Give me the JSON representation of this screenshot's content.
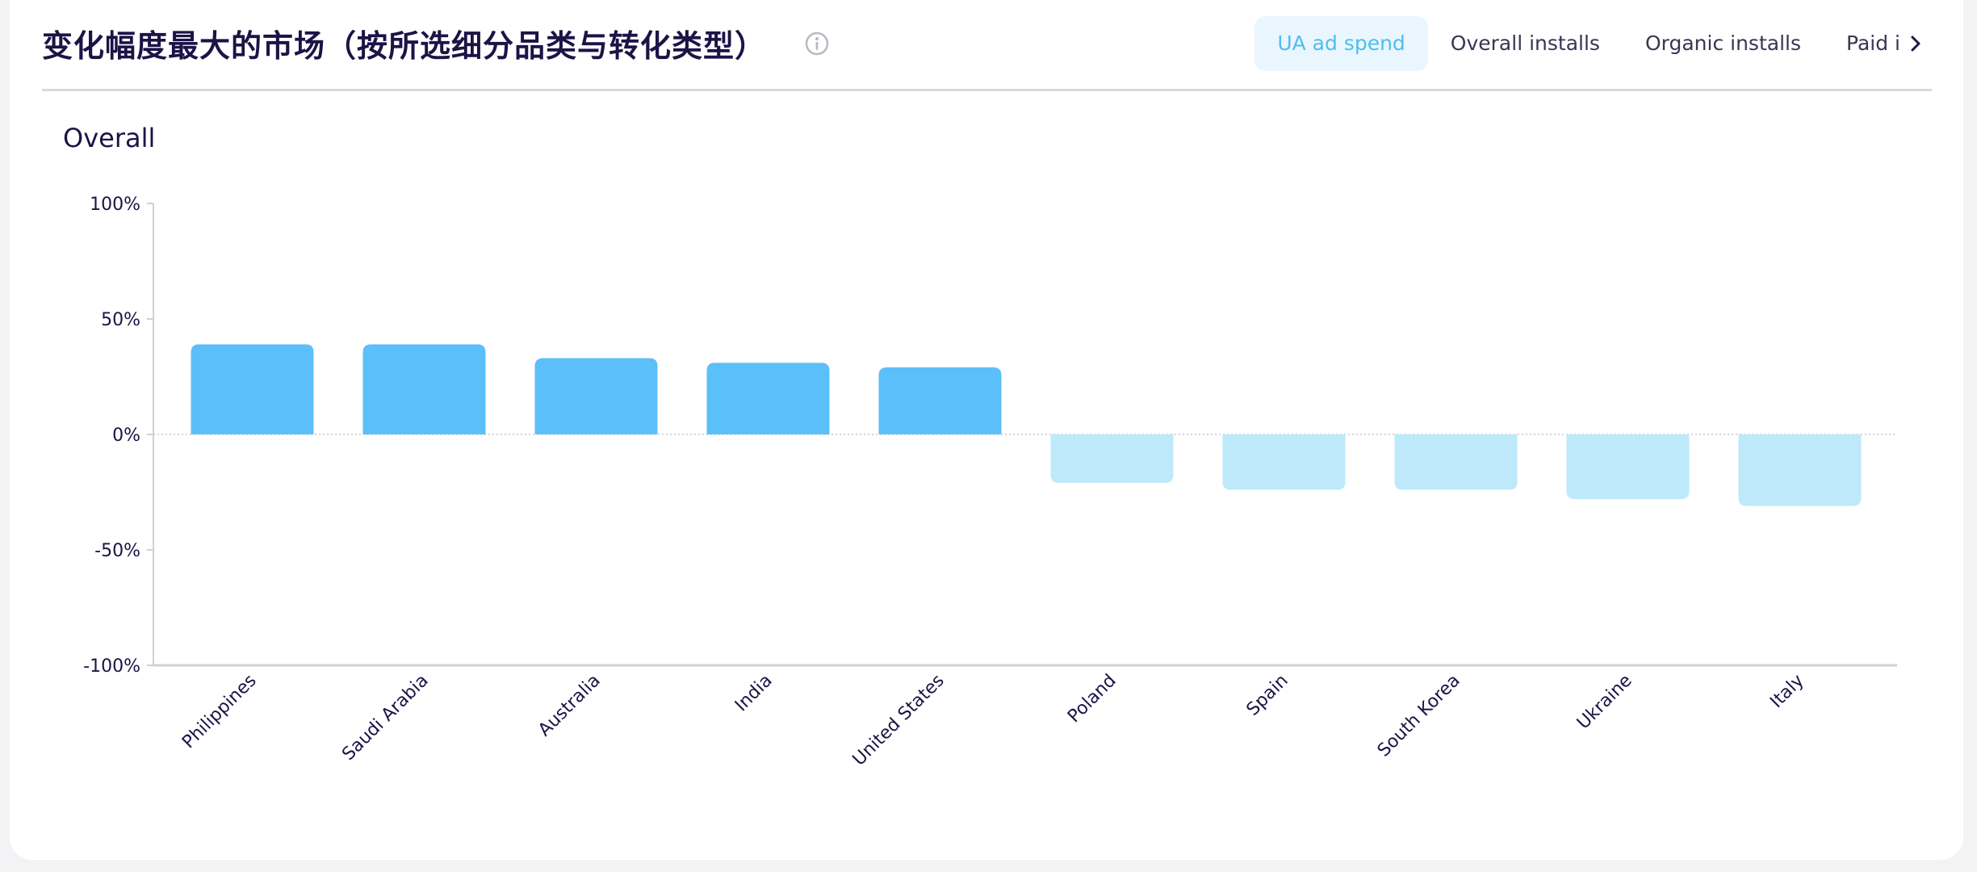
{
  "header": {
    "title": "变化幅度最大的市场（按所选细分品类与转化类型）",
    "info_icon": "info-icon",
    "tabs": [
      {
        "label": "UA ad spend",
        "active": true
      },
      {
        "label": "Overall installs",
        "active": false
      },
      {
        "label": "Organic installs",
        "active": false
      },
      {
        "label": "Paid installs",
        "active": false
      }
    ],
    "next_icon": "chevron-right-icon"
  },
  "section": {
    "title": "Overall"
  },
  "colors": {
    "positive": "#5bbff9",
    "negative": "#bde9fb",
    "accent": "#4fbdf0",
    "axis": "#d0d0d5"
  },
  "chart_data": {
    "type": "bar",
    "title": "Overall",
    "categories": [
      "Philippines",
      "Saudi Arabia",
      "Australia",
      "India",
      "United States",
      "Poland",
      "Spain",
      "South Korea",
      "Ukraine",
      "Italy"
    ],
    "values": [
      39,
      39,
      33,
      31,
      29,
      -21,
      -24,
      -24,
      -28,
      -31
    ],
    "unit": "%",
    "ylim": [
      -100,
      100
    ],
    "yticks": [
      "100%",
      "50%",
      "0%",
      "-50%",
      "-100%"
    ],
    "ytick_values": [
      100,
      50,
      0,
      -50,
      -100
    ],
    "grid": false,
    "legend": "none"
  }
}
